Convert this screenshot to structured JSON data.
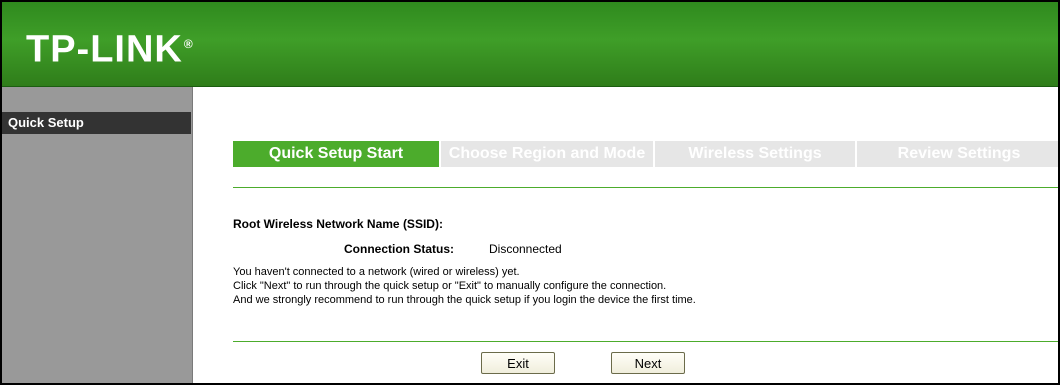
{
  "header": {
    "logo": "TP-LINK",
    "logo_mark": "®"
  },
  "sidebar": {
    "items": [
      {
        "label": "Quick Setup"
      }
    ]
  },
  "steps": [
    {
      "label": "Quick Setup Start"
    },
    {
      "label": "Choose Region and Mode"
    },
    {
      "label": "Wireless Settings"
    },
    {
      "label": "Review Settings"
    }
  ],
  "main": {
    "ssid_label": "Root Wireless Network Name (SSID):",
    "connection_status_label": "Connection Status:",
    "connection_status_value": "Disconnected",
    "messages": [
      "You haven't connected to a network (wired or wireless) yet.",
      "Click \"Next\" to run through the quick setup or \"Exit\" to manually configure the connection.",
      "And we strongly recommend to run through the quick setup if you login the device the first time."
    ]
  },
  "buttons": {
    "exit": "Exit",
    "next": "Next"
  },
  "colors": {
    "brand_green": "#4cac2c",
    "header_green": "#3f9e28",
    "sidebar_gray": "#999999",
    "active_item": "#333333"
  }
}
